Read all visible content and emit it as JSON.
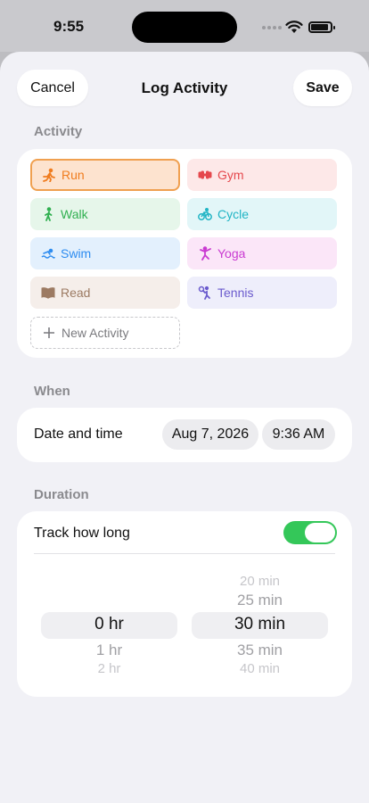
{
  "status": {
    "time": "9:55"
  },
  "header": {
    "cancel_label": "Cancel",
    "title": "Log Activity",
    "save_label": "Save"
  },
  "activity_section": {
    "label": "Activity",
    "chips": [
      {
        "label": "Run",
        "icon": "run-icon",
        "bg": "#fde3cf",
        "color": "#f07c1e",
        "selected": true
      },
      {
        "label": "Gym",
        "icon": "dumbbell-icon",
        "bg": "#fde8e8",
        "color": "#e5484d"
      },
      {
        "label": "Walk",
        "icon": "walk-icon",
        "bg": "#e6f6ea",
        "color": "#30b050"
      },
      {
        "label": "Cycle",
        "icon": "bicycle-icon",
        "bg": "#e2f6f8",
        "color": "#1fb4c4"
      },
      {
        "label": "Swim",
        "icon": "swim-icon",
        "bg": "#e3f0fd",
        "color": "#2d8cf0"
      },
      {
        "label": "Yoga",
        "icon": "yoga-icon",
        "bg": "#fbe6f8",
        "color": "#c93ad1"
      },
      {
        "label": "Read",
        "icon": "book-icon",
        "bg": "#f5eeea",
        "color": "#9c7a62"
      },
      {
        "label": "Tennis",
        "icon": "tennis-icon",
        "bg": "#eeeefb",
        "color": "#6a5acd"
      }
    ],
    "new_label": "New Activity"
  },
  "when_section": {
    "label": "When",
    "row_label": "Date and time",
    "date": "Aug 7, 2026",
    "time": "9:36 AM"
  },
  "duration_section": {
    "label": "Duration",
    "track_label": "Track how long",
    "track_enabled": true,
    "hours_options": [
      "0 hr",
      "1 hr",
      "2 hr"
    ],
    "minutes_options": [
      "20 min",
      "25 min",
      "30 min",
      "35 min",
      "40 min"
    ],
    "selected_hours": "0 hr",
    "selected_minutes": "30 min"
  }
}
